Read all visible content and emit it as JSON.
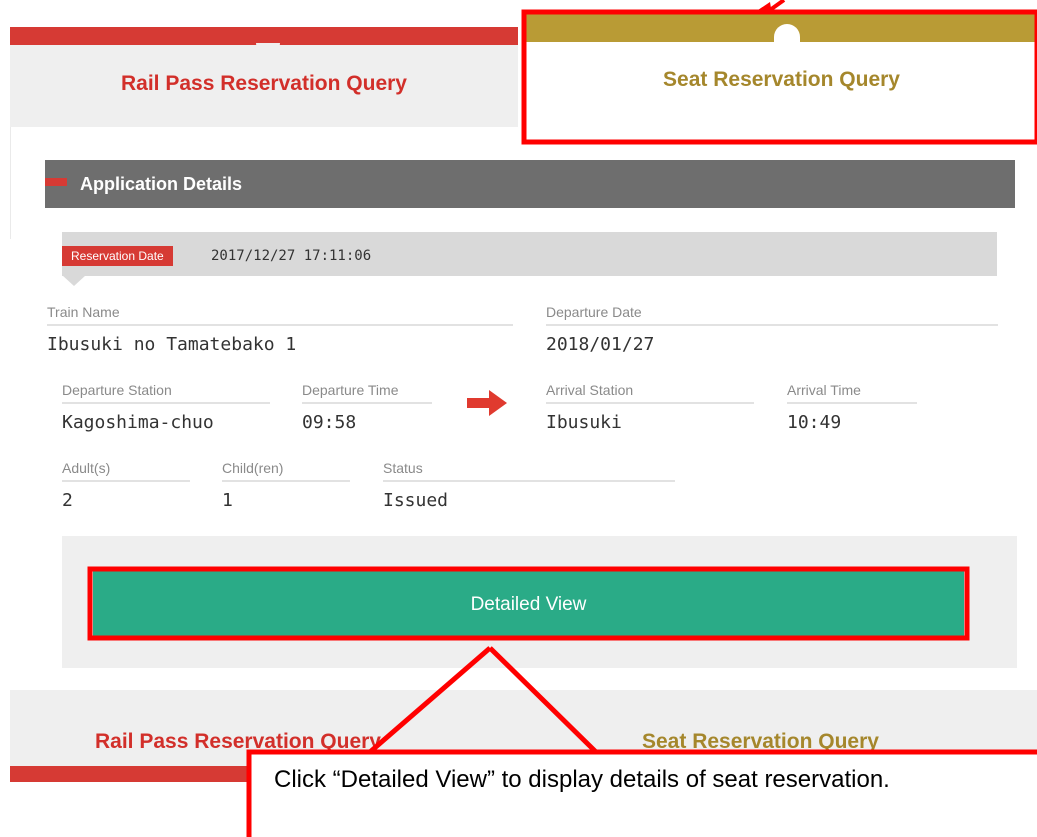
{
  "tabs_top": {
    "rail_pass": "Rail Pass Reservation Query",
    "seat": "Seat Reservation Query"
  },
  "application": {
    "title": "Application Details",
    "reservation_date_label": "Reservation Date",
    "reservation_date_value": "2017/12/27 17:11:06",
    "train_name_label": "Train Name",
    "train_name_value": "Ibusuki no Tamatebako 1",
    "departure_date_label": "Departure Date",
    "departure_date_value": "2018/01/27",
    "departure_station_label": "Departure Station",
    "departure_station_value": "Kagoshima-chuo",
    "departure_time_label": "Departure Time",
    "departure_time_value": "09:58",
    "arrival_station_label": "Arrival Station",
    "arrival_station_value": "Ibusuki",
    "arrival_time_label": "Arrival Time",
    "arrival_time_value": "10:49",
    "adults_label": "Adult(s)",
    "adults_value": "2",
    "children_label": "Child(ren)",
    "children_value": "1",
    "status_label": "Status",
    "status_value": "Issued",
    "detail_button": "Detailed View"
  },
  "tabs_bottom": {
    "rail_pass": "Rail Pass Reservation Query",
    "seat": "Seat Reservation Query"
  },
  "annotation": {
    "callout": "Click “Detailed View” to display details of seat reservation."
  },
  "colors": {
    "rail_red": "#d63a34",
    "seat_gold": "#b99b35",
    "button_green": "#2aab87",
    "header_gray": "#6e6e6e",
    "highlight_red": "#ff0000"
  },
  "icons": {
    "route_arrow": "right-arrow-icon"
  }
}
